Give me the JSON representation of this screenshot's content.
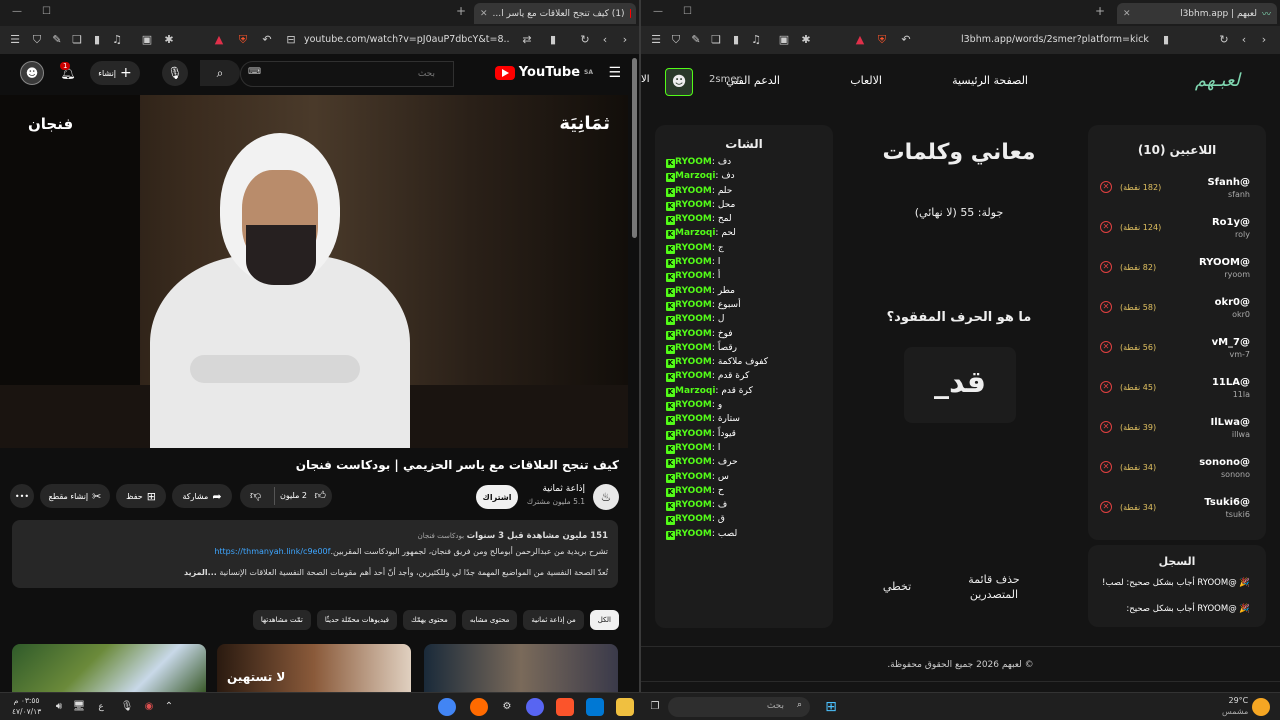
{
  "left": {
    "tab_title": "(1) كيف تنجح العلاقات مع ياسر ا...",
    "url": "youtube.com/watch?v=pJ0auP7dbcY&t=8...",
    "yt": {
      "logo": "YouTube",
      "region": "SA",
      "search_placeholder": "بحث",
      "create_label": "إنشاء",
      "notif_count": "1",
      "video_label_right": "ثمَانِيَة",
      "video_label_left": "فنجان",
      "title": "كيف تنجح العلاقات مع ياسر الحزيمي | بودكاست فنجان",
      "channel": "إذاعة ثمانية",
      "subs": "5.1 مليون مشترك",
      "subscribe": "اشتراك",
      "likes": "2 مليون",
      "share": "مشاركة",
      "save": "حفظ",
      "clip": "إنشاء مقطع",
      "more": "•••",
      "desc_stats": "151 مليون مشاهدة قبل 3 سنوات",
      "desc_tag": "بودكاست فنجان",
      "desc_line1a": "تشرح بريدية من عبدالرحمن أبومالح ومن فريق فنجان، لجمهور البودكاست المقربين.",
      "desc_link": "https://thmanyah.link/c9e00f",
      "desc_line2": "تُعدّ الصحة النفسية من المواضيع المهمة جدًا لي وللكثيرين، وأجد أنّ أحد أهم مقومات الصحة النفسية العلاقات الإنسانية",
      "desc_more": "...المزيد",
      "chips": [
        "الكل",
        "من إذاعة ثمانية",
        "محتوى مشابه",
        "محتوى يهمّك",
        "فيديوهات محمّلة حديثًا",
        "تمّت مشاهدتها"
      ],
      "thumb_text": "لا تستهين"
    }
  },
  "right": {
    "tab_title": "لعبهم | l3bhm.app",
    "url": "l3bhm.app/words/2smer?platform=kick",
    "nav": {
      "logo": "لعبـهم",
      "home": "الصفحة الرئيسية",
      "games": "الالعاب",
      "support": "الدعم الفني",
      "user": "2smer",
      "other": "الا"
    },
    "players_title": "اللاعبين (10)",
    "players": [
      {
        "name": "@Sfanh",
        "sub": "sfanh",
        "pts": "(182 نقطة)"
      },
      {
        "name": "@Ro1y",
        "sub": "roly",
        "pts": "(124 نقطة)"
      },
      {
        "name": "@RYOOM",
        "sub": "ryoom",
        "pts": "(82 نقطة)"
      },
      {
        "name": "@okr0",
        "sub": "okr0",
        "pts": "(58 نقطة)"
      },
      {
        "name": "@vM_7",
        "sub": "vm-7",
        "pts": "(56 نقطة)"
      },
      {
        "name": "@11LA",
        "sub": "11la",
        "pts": "(45 نقطة)"
      },
      {
        "name": "@IlLwa",
        "sub": "illwa",
        "pts": "(39 نقطة)"
      },
      {
        "name": "@sonono",
        "sub": "sonono",
        "pts": "(34 نقطة)"
      },
      {
        "name": "@Tsuki6",
        "sub": "tsuki6",
        "pts": "(34 نقطة)"
      }
    ],
    "log_title": "السجل",
    "log": [
      "🎉 @RYOOM أجاب بشكل صحيح: لصب!",
      "🎉 @RYOOM أجاب بشكل صحيح:"
    ],
    "game_title": "معاني وكلمات",
    "round": "جولة: 55 (لا نهائي)",
    "question": "ما هو الحرف المفقود؟",
    "word": "قد_",
    "btn_reset": "حذف قائمة المتصدرين",
    "btn_skip": "تخطي",
    "chat_title": "الشات",
    "chat": [
      {
        "u": "RYOOM",
        "m": "دف"
      },
      {
        "u": "Marzoqi",
        "m": "دف"
      },
      {
        "u": "RYOOM",
        "m": "حلم"
      },
      {
        "u": "RYOOM",
        "m": "محل"
      },
      {
        "u": "RYOOM",
        "m": "لمح"
      },
      {
        "u": "Marzoqi",
        "m": "لحم"
      },
      {
        "u": "RYOOM",
        "m": "ج"
      },
      {
        "u": "RYOOM",
        "m": "ا"
      },
      {
        "u": "RYOOM",
        "m": "أ"
      },
      {
        "u": "RYOOM",
        "m": "مطر"
      },
      {
        "u": "RYOOM",
        "m": "أسبوع"
      },
      {
        "u": "RYOOM",
        "m": "ل"
      },
      {
        "u": "RYOOM",
        "m": "فوخ"
      },
      {
        "u": "RYOOM",
        "m": "رقصاً"
      },
      {
        "u": "RYOOM",
        "m": "كفوف ملاكمة"
      },
      {
        "u": "RYOOM",
        "m": "كرة قدم"
      },
      {
        "u": "Marzoqi",
        "m": "كرة قدم"
      },
      {
        "u": "RYOOM",
        "m": "و"
      },
      {
        "u": "RYOOM",
        "m": "ستارة"
      },
      {
        "u": "RYOOM",
        "m": "قيوداً"
      },
      {
        "u": "RYOOM",
        "m": "ا"
      },
      {
        "u": "RYOOM",
        "m": "حرف"
      },
      {
        "u": "RYOOM",
        "m": "س"
      },
      {
        "u": "RYOOM",
        "m": "ح"
      },
      {
        "u": "RYOOM",
        "m": "ف"
      },
      {
        "u": "RYOOM",
        "m": "ق"
      },
      {
        "u": "RYOOM",
        "m": "لصب"
      }
    ],
    "footer": "© لعبهم 2026 جميع الحقوق محفوظة."
  },
  "taskbar": {
    "weather_temp": "29°C",
    "weather_desc": "مشمس",
    "search": "بحث",
    "time": "٠٣:٥٥ م",
    "date": "٤٧/٠٧/١٣",
    "lang": "ع"
  },
  "colors": {
    "kick_green": "#53fc18",
    "yt_red": "#ff0000",
    "accent_teal": "#7fd6b0"
  }
}
